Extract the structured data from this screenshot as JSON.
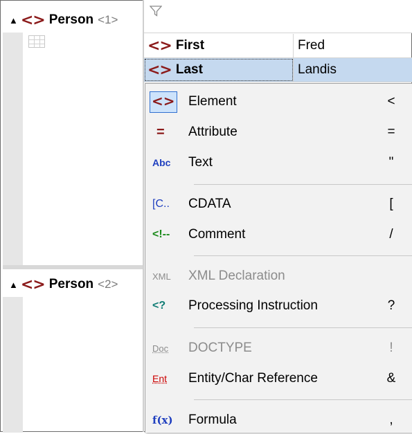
{
  "left_pane": {
    "person_1": {
      "tri": "▲",
      "glyph": "<>",
      "name": "Person",
      "index": "<1>"
    },
    "person_2": {
      "tri": "▲",
      "glyph": "<>",
      "name": "Person",
      "index": "<2>"
    }
  },
  "grid": {
    "rows": [
      {
        "glyph": "<>",
        "name": "First",
        "value": "Fred",
        "selected": false
      },
      {
        "glyph": "<>",
        "name": "Last",
        "value": "Landis",
        "selected": true
      }
    ]
  },
  "context_menu": {
    "items": [
      {
        "icon": "<>",
        "label": "Element",
        "shortcut": "<",
        "disabled": false
      },
      {
        "icon": "=",
        "label": "Attribute",
        "shortcut": "=",
        "disabled": false
      },
      {
        "icon": "Abc",
        "label": "Text",
        "shortcut": "\"",
        "disabled": false
      },
      {
        "icon": "[C..",
        "label": "CDATA",
        "shortcut": "[",
        "disabled": false
      },
      {
        "icon": "<!--",
        "label": "Comment",
        "shortcut": "/",
        "disabled": false
      },
      {
        "icon": "XML",
        "label": "XML Declaration",
        "shortcut": "",
        "disabled": true
      },
      {
        "icon": "<?",
        "label": "Processing Instruction",
        "shortcut": "?",
        "disabled": false
      },
      {
        "icon": "Doc",
        "label": "DOCTYPE",
        "shortcut": "!",
        "disabled": true
      },
      {
        "icon": "Ent",
        "label": "Entity/Char Reference",
        "shortcut": "&",
        "disabled": false
      },
      {
        "icon": "f(x)",
        "label": "Formula",
        "shortcut": ",",
        "disabled": false
      }
    ]
  },
  "colors": {
    "element_glyph": "#8b1a1a",
    "selection": "#c5d9ef",
    "menu_bg": "#f2f2f2",
    "text_icon": "#1f3fbf",
    "comment_icon": "#1a8a1a",
    "pi_icon": "#0f7c74",
    "entity_icon": "#cc0000",
    "disabled": "#8c8c8c"
  }
}
